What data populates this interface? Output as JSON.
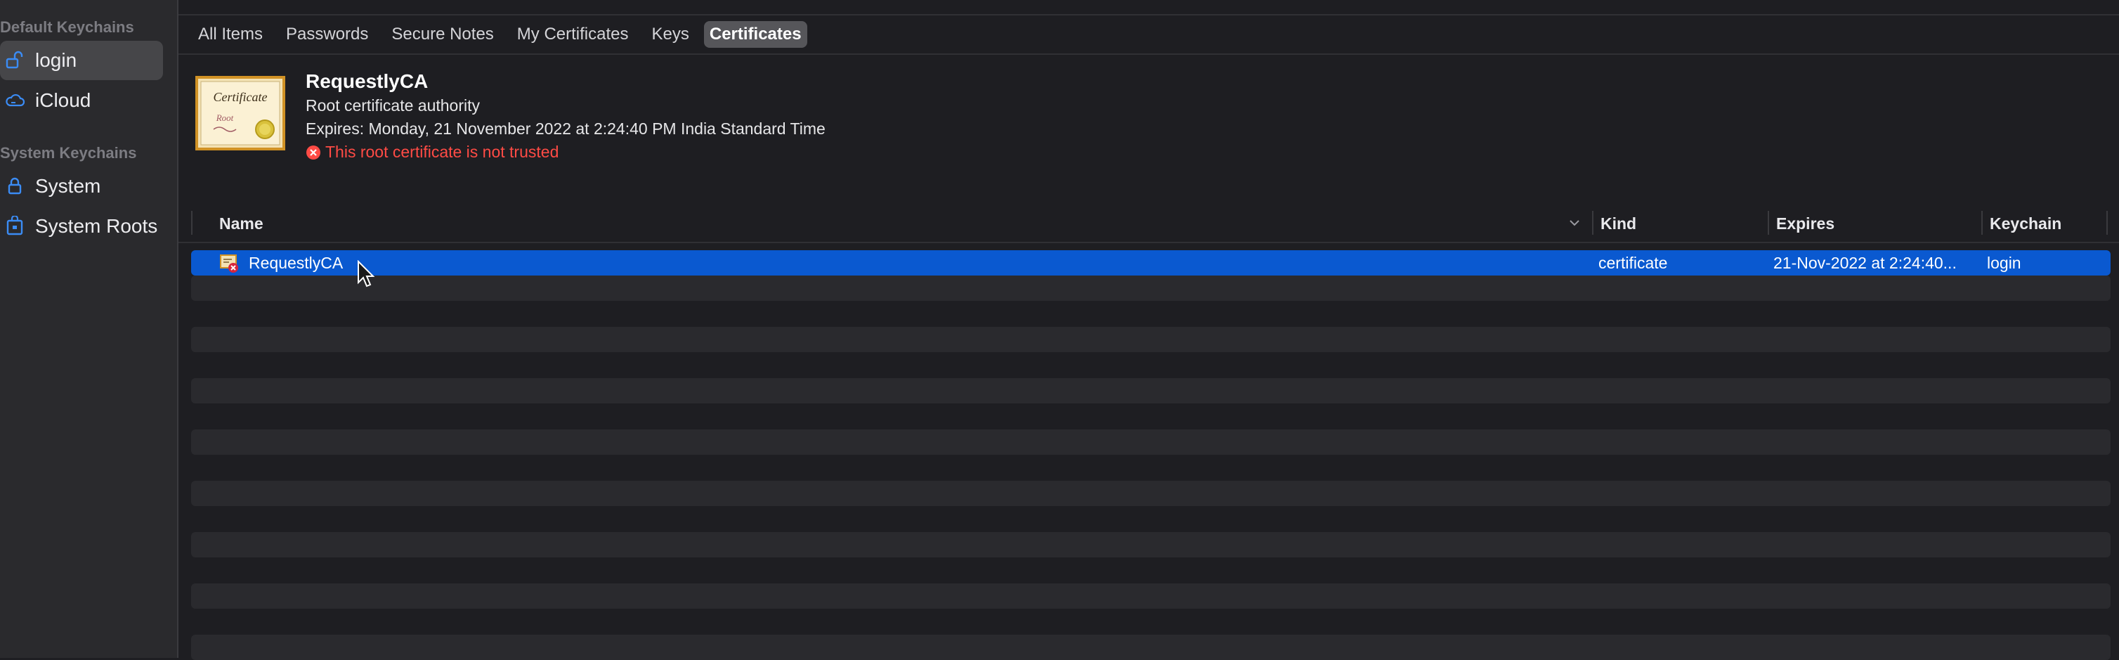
{
  "sidebar": {
    "sections": [
      {
        "title": "Default Keychains",
        "items": [
          {
            "label": "login",
            "icon": "unlocked-padlock-icon",
            "selected": true
          },
          {
            "label": "iCloud",
            "icon": "icloud-icon",
            "selected": false
          }
        ]
      },
      {
        "title": "System Keychains",
        "items": [
          {
            "label": "System",
            "icon": "padlock-icon",
            "selected": false
          },
          {
            "label": "System Roots",
            "icon": "keychain-cabinet-icon",
            "selected": false
          }
        ]
      }
    ]
  },
  "toolbar": {
    "tabs": [
      "All Items",
      "Passwords",
      "Secure Notes",
      "My Certificates",
      "Keys",
      "Certificates"
    ],
    "active_tab": "Certificates"
  },
  "certificate": {
    "name": "RequestlyCA",
    "subtitle": "Root certificate authority",
    "expires_line": "Expires: Monday, 21 November 2022 at 2:24:40 PM India Standard Time",
    "warning": "This root certificate is not trusted",
    "image_text_1": "Certificate",
    "image_text_2": "Root"
  },
  "table": {
    "columns": [
      "Name",
      "Kind",
      "Expires",
      "Keychain"
    ],
    "rows": [
      {
        "name": "RequestlyCA",
        "kind": "certificate",
        "expires": "21-Nov-2022 at 2:24:40...",
        "keychain": "login",
        "selected": true
      }
    ]
  },
  "colors": {
    "selection": "#0a59d0",
    "accent_icon": "#3b8cf5",
    "warning": "#ff4b45",
    "background": "#1e1e22",
    "sidebar": "#2a2a2d"
  }
}
